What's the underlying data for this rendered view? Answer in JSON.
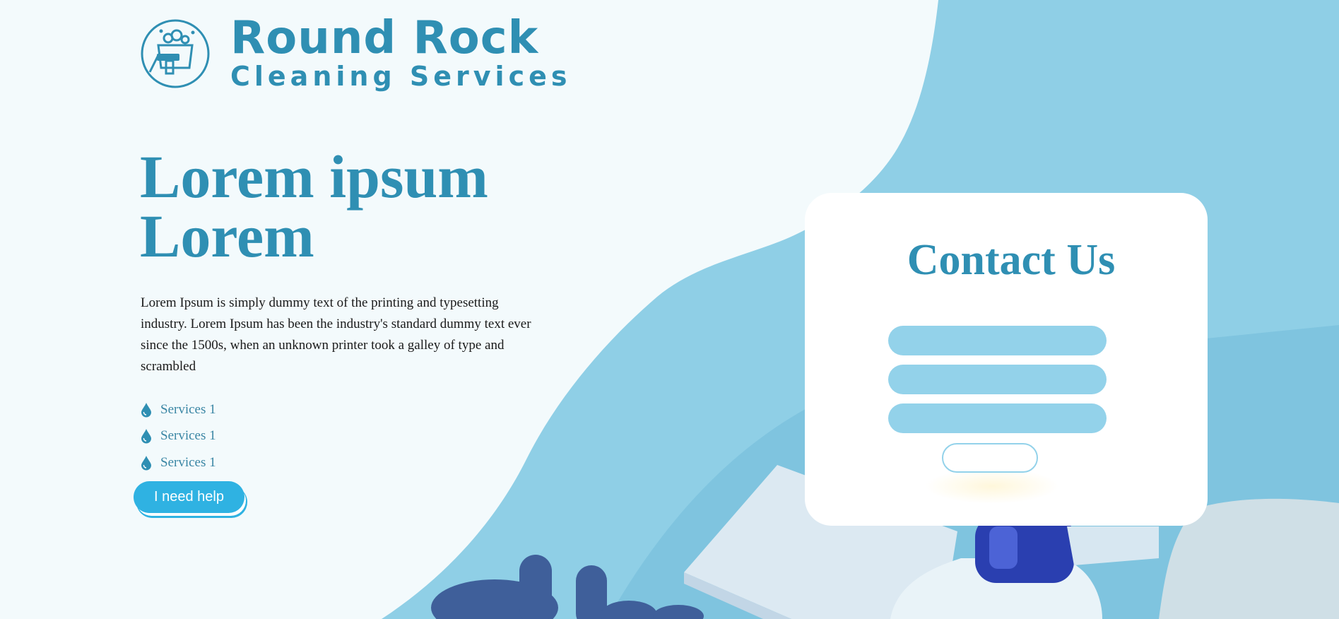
{
  "brand": {
    "name": "Round Rock",
    "tagline": "Cleaning Services",
    "color": "#2f8fb3"
  },
  "hero": {
    "title_line1": "Lorem ipsum",
    "title_line2": "Lorem",
    "description": "Lorem Ipsum is simply dummy text of the printing and typesetting industry. Lorem Ipsum has been the industry's standard dummy text ever since the 1500s, when an unknown printer took a galley of type and scrambled",
    "services": [
      {
        "label": "Services 1",
        "icon": "water-drop-icon"
      },
      {
        "label": "Services 1",
        "icon": "water-drop-icon"
      },
      {
        "label": "Services 1",
        "icon": "water-drop-icon"
      }
    ],
    "cta_label": "I need help",
    "cta_color": "#2fb2e2"
  },
  "contact": {
    "title": "Contact Us",
    "fields": [
      {
        "value": "",
        "placeholder": ""
      },
      {
        "value": "",
        "placeholder": ""
      },
      {
        "value": "",
        "placeholder": ""
      }
    ],
    "submit_label": "",
    "field_color": "#93d2ea"
  },
  "colors": {
    "page_light": "#f3fafc",
    "background_blue": "#8fcfe6"
  }
}
